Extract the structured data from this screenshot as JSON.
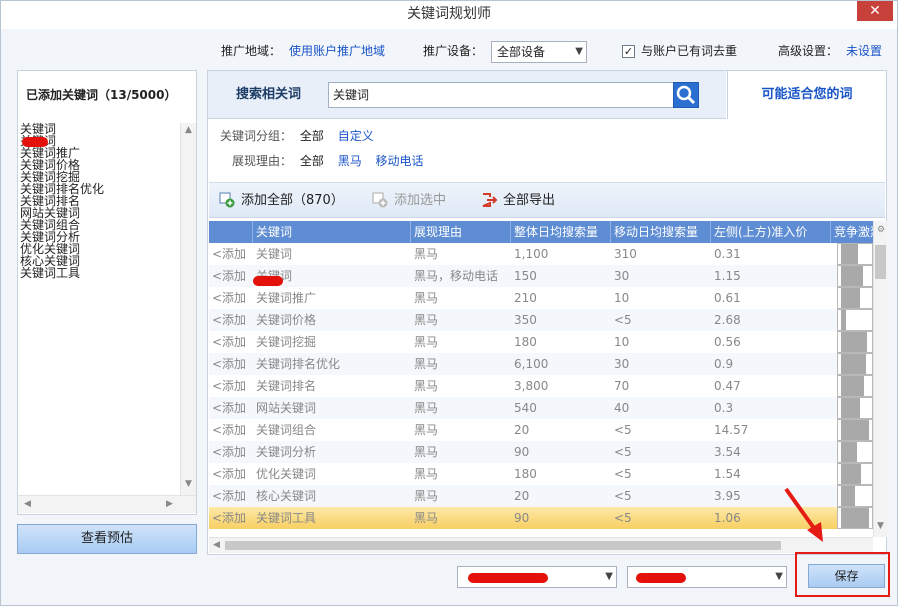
{
  "window": {
    "title": "关键词规划师",
    "close_glyph": "✕"
  },
  "top": {
    "region_label": "推广地域：",
    "region_link": "使用账户推广地域",
    "device_label": "推广设备：",
    "device_value": "全部设备",
    "dedupe_checked": true,
    "dedupe_label": "与账户已有词去重",
    "advanced_label": "高级设置：",
    "advanced_value": "未设置"
  },
  "left": {
    "title": "已添加关键词（13/5000）",
    "items": [
      "关键词",
      "关键词",
      "关键词推广",
      "关键词价格",
      "关键词挖掘",
      "关键词排名优化",
      "关键词排名",
      "网站关键词",
      "关键词组合",
      "关键词分析",
      "优化关键词",
      "核心关键词",
      "关键词工具"
    ],
    "preview_button": "查看预估"
  },
  "search": {
    "tab_label": "搜索相关词",
    "input_value": "关键词",
    "suggest_tab": "可能适合您的词"
  },
  "filters": {
    "group_label": "关键词分组：",
    "group_all": "全部",
    "group_custom": "自定义",
    "reason_label": "展现理由：",
    "reason_all": "全部",
    "reason_1": "黑马",
    "reason_2": "移动电话"
  },
  "toolbar": {
    "add_all": "添加全部（870）",
    "add_selected": "添加选中",
    "export_all": "全部导出"
  },
  "table": {
    "columns": [
      "",
      "关键词",
      "展现理由",
      "整体日均搜索量",
      "移动日均搜索量",
      "左侧(上方)准入价",
      "竞争激烈"
    ],
    "rows": [
      {
        "action": "<添加",
        "kw": "关键词",
        "reason": "黑马",
        "total": "1,100",
        "mobile": "310",
        "price": "0.31",
        "comp": 0.55
      },
      {
        "action": "<添加",
        "kw": "关键词",
        "reason": "黑马，移动电话",
        "total": "150",
        "mobile": "30",
        "price": "1.15",
        "comp": 0.7
      },
      {
        "action": "<添加",
        "kw": "关键词推广",
        "reason": "黑马",
        "total": "210",
        "mobile": "10",
        "price": "0.61",
        "comp": 0.6
      },
      {
        "action": "<添加",
        "kw": "关键词价格",
        "reason": "黑马",
        "total": "350",
        "mobile": "<5",
        "price": "2.68",
        "comp": 0.15
      },
      {
        "action": "<添加",
        "kw": "关键词挖掘",
        "reason": "黑马",
        "total": "180",
        "mobile": "10",
        "price": "0.56",
        "comp": 0.85
      },
      {
        "action": "<添加",
        "kw": "关键词排名优化",
        "reason": "黑马",
        "total": "6,100",
        "mobile": "30",
        "price": "0.9",
        "comp": 0.8
      },
      {
        "action": "<添加",
        "kw": "关键词排名",
        "reason": "黑马",
        "total": "3,800",
        "mobile": "70",
        "price": "0.47",
        "comp": 0.75
      },
      {
        "action": "<添加",
        "kw": "网站关键词",
        "reason": "黑马",
        "total": "540",
        "mobile": "40",
        "price": "0.3",
        "comp": 0.6
      },
      {
        "action": "<添加",
        "kw": "关键词组合",
        "reason": "黑马",
        "total": "20",
        "mobile": "<5",
        "price": "14.57",
        "comp": 0.9
      },
      {
        "action": "<添加",
        "kw": "关键词分析",
        "reason": "黑马",
        "total": "90",
        "mobile": "<5",
        "price": "3.54",
        "comp": 0.5
      },
      {
        "action": "<添加",
        "kw": "优化关键词",
        "reason": "黑马",
        "total": "180",
        "mobile": "<5",
        "price": "1.54",
        "comp": 0.65
      },
      {
        "action": "<添加",
        "kw": "核心关键词",
        "reason": "黑马",
        "total": "20",
        "mobile": "<5",
        "price": "3.95",
        "comp": 0.45
      },
      {
        "action": "<添加",
        "kw": "关键词工具",
        "reason": "黑马",
        "total": "90",
        "mobile": "<5",
        "price": "1.06",
        "comp": 0.9
      }
    ]
  },
  "footer": {
    "save_button": "保存"
  }
}
